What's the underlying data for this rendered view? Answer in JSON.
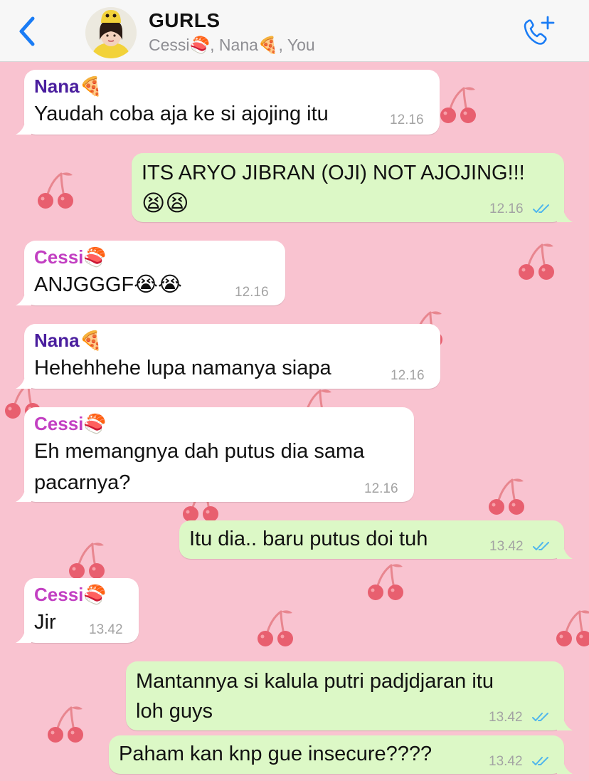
{
  "header": {
    "title": "GURLS",
    "members": "Cessi🍣, Nana🍕, You",
    "back_icon": "chevron-left-icon",
    "call_icon": "add-call-icon",
    "accent_color": "#1a7cf5"
  },
  "messages": [
    {
      "sender": "Nana🍕",
      "lines": [
        "Yaudah coba aja ke si ajojing itu"
      ],
      "time": "12.16"
    },
    {
      "lines": [
        "ITS ARYO JIBRAN (OJI) NOT AJOJING!!!",
        "😫😫"
      ],
      "time": "12.16",
      "read": true
    },
    {
      "sender": "Cessi🍣",
      "lines": [
        "ANJGGGF😭😭"
      ],
      "time": "12.16"
    },
    {
      "sender": "Nana🍕",
      "lines": [
        "Hehehhehe lupa namanya siapa"
      ],
      "time": "12.16"
    },
    {
      "sender": "Cessi🍣",
      "lines": [
        "Eh memangnya dah putus dia sama",
        "pacarnya?"
      ],
      "time": "12.16"
    },
    {
      "lines": [
        "Itu dia.. baru putus doi tuh"
      ],
      "time": "13.42",
      "read": true
    },
    {
      "sender": "Cessi🍣",
      "lines": [
        "Jir"
      ],
      "time": "13.42"
    },
    {
      "lines": [
        "Mantannya si kalula putri padjdjaran itu",
        "loh guys"
      ],
      "time": "13.42",
      "read": true
    },
    {
      "lines": [
        "Paham kan knp gue insecure????"
      ],
      "time": "13.42",
      "read": true
    }
  ],
  "colors": {
    "wallpaper": "#f9c3d0",
    "incoming_bubble": "#ffffff",
    "outgoing_bubble": "#dcf8c6",
    "nana_name": "#4a1e9e",
    "cessi_name": "#c23fc2",
    "read_ticks": "#4fb6ec"
  }
}
